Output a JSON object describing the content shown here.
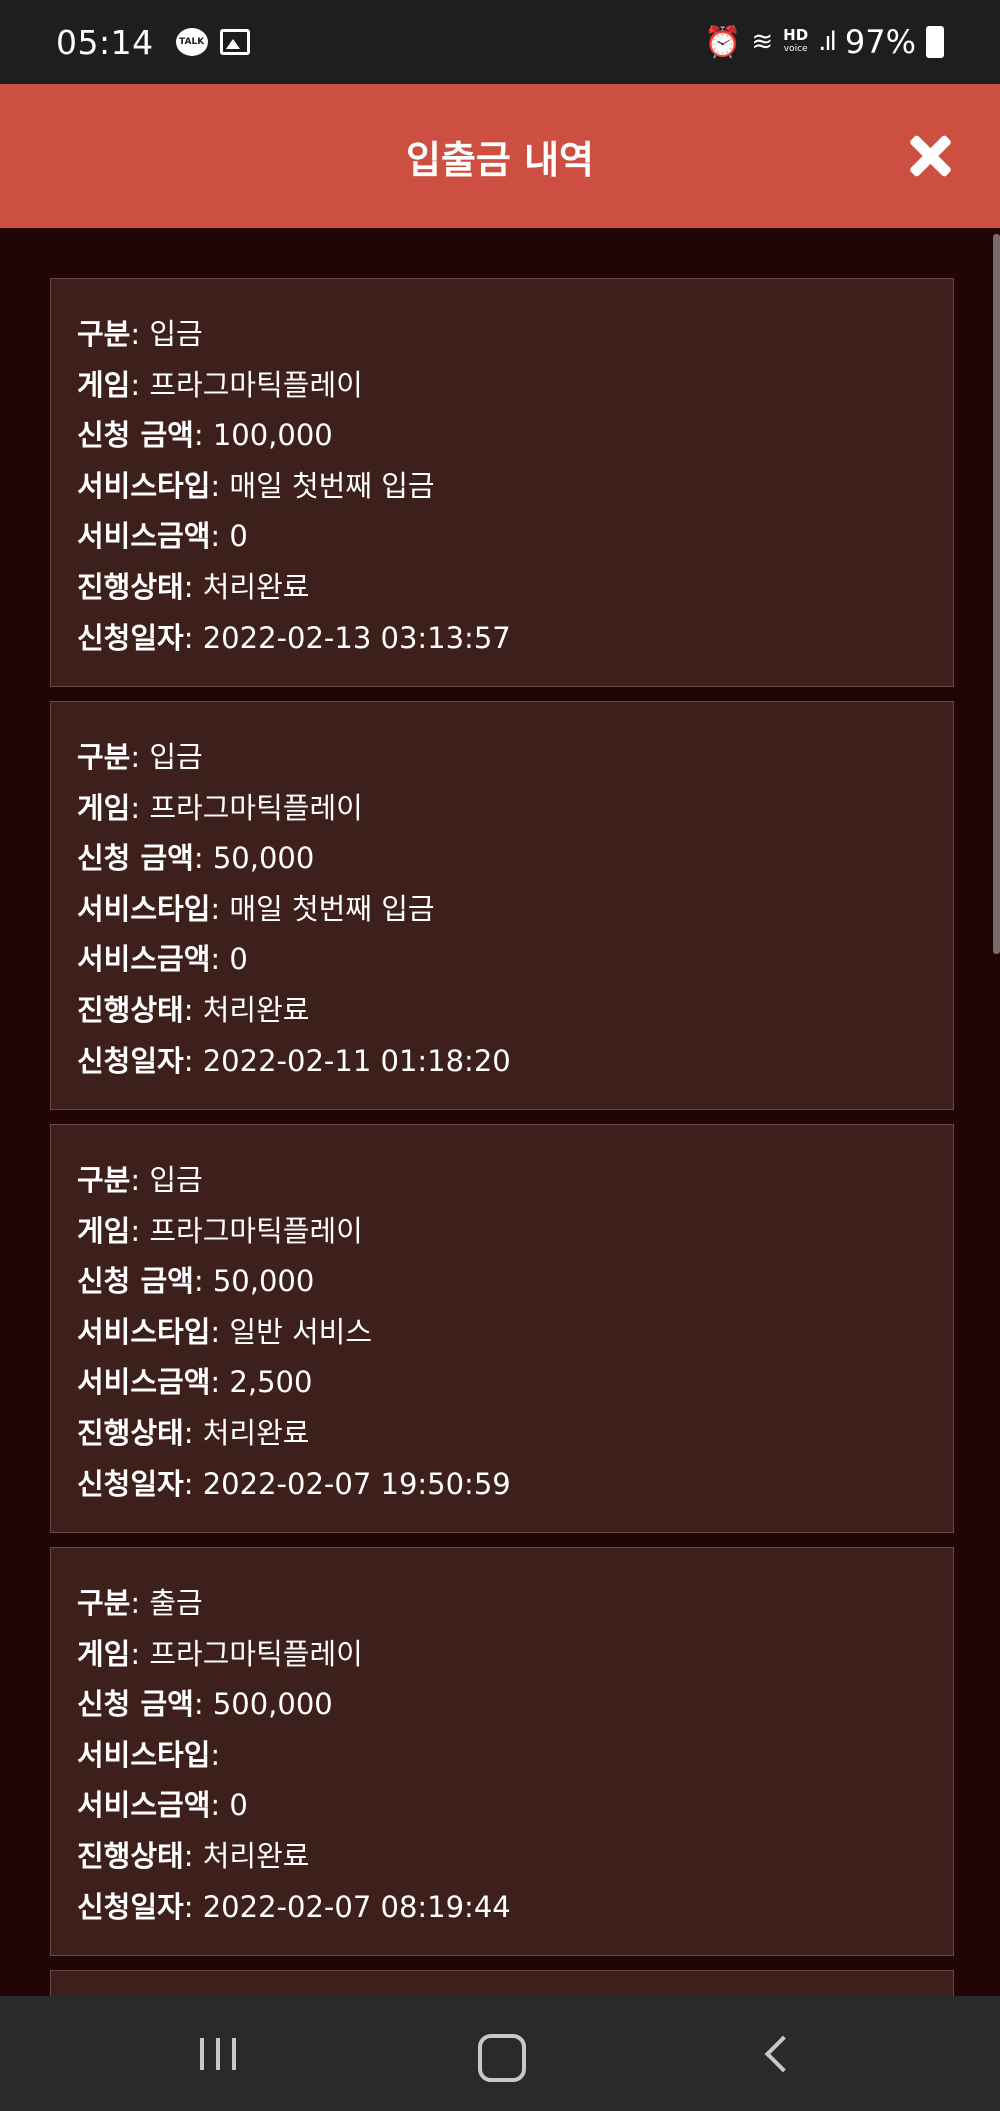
{
  "status_bar": {
    "time": "05:14",
    "talk_badge": "TALK",
    "hd_label": "HD",
    "voice_label": "voice",
    "battery": "97%"
  },
  "header": {
    "title": "입출금 내역"
  },
  "labels": {
    "type": "구분",
    "game": "게임",
    "amount": "신청 금액",
    "service_type": "서비스타입",
    "service_amount": "서비스금액",
    "status": "진행상태",
    "date": "신청일자"
  },
  "records": [
    {
      "type": "입금",
      "game": "프라그마틱플레이",
      "amount": "100,000",
      "service_type": "매일 첫번째 입금",
      "service_amount": "0",
      "status": "처리완료",
      "date": "2022-02-13 03:13:57"
    },
    {
      "type": "입금",
      "game": "프라그마틱플레이",
      "amount": "50,000",
      "service_type": "매일 첫번째 입금",
      "service_amount": "0",
      "status": "처리완료",
      "date": "2022-02-11 01:18:20"
    },
    {
      "type": "입금",
      "game": "프라그마틱플레이",
      "amount": "50,000",
      "service_type": "일반 서비스",
      "service_amount": "2,500",
      "status": "처리완료",
      "date": "2022-02-07 19:50:59"
    },
    {
      "type": "출금",
      "game": "프라그마틱플레이",
      "amount": "500,000",
      "service_type": "",
      "service_amount": "0",
      "status": "처리완료",
      "date": "2022-02-07 08:19:44"
    }
  ],
  "colors": {
    "header": "#cc4f42",
    "background": "#220605",
    "card": "#3d1f1c",
    "card_border": "#6a4744"
  }
}
